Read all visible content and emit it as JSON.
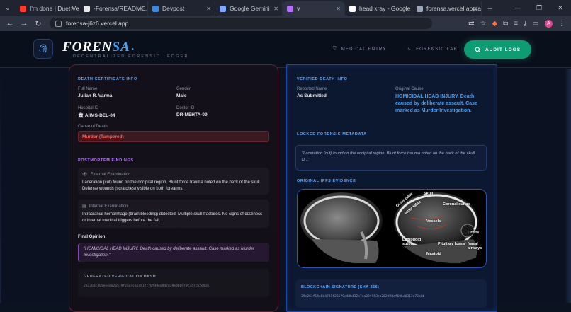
{
  "browser": {
    "tabs": [
      {
        "title": "I'm done | Duet Vers...",
        "fav_color": "#ff3b30",
        "active": false
      },
      {
        "title": "-Forensa/README.m...",
        "fav_color": "#e6e8ec",
        "active": false
      },
      {
        "title": "Devpost",
        "fav_color": "#3a8dde",
        "active": false
      },
      {
        "title": "Google Gemini",
        "fav_color": "#7fa7ff",
        "active": false
      },
      {
        "title": "v",
        "fav_color": "#b66cff",
        "active": true
      },
      {
        "title": "head xray - Google S...",
        "fav_color": "#ffffff",
        "active": false
      },
      {
        "title": "forensa.vercel.app/au...",
        "fav_color": "#9aa4b5",
        "active": false
      }
    ],
    "url": "forensa-j6z6.vercel.app",
    "avatar_letter": "A"
  },
  "header": {
    "brand_main": "FOREN",
    "brand_accent": "SA",
    "tagline": "DECENTRALIZED FORENSIC LEDGER",
    "nav": {
      "medical_entry": "MEDICAL ENTRY",
      "forensic_lab": "FORENSIC LAB",
      "audit_logs": "AUDIT LOGS"
    }
  },
  "left": {
    "title": "DEATH CERTIFICATE INFO",
    "full_name_label": "Full Name",
    "full_name": "Julian R. Varma",
    "gender_label": "Gender",
    "gender": "Male",
    "hospital_label": "Hospital ID",
    "hospital": "AIIMS-DEL-04",
    "doctor_label": "Doctor ID",
    "doctor": "DR-MEHTA-09",
    "cause_label": "Cause of Death",
    "cause": "Murder (Tampered)",
    "findings_title": "POSTMORTEM FINDINGS",
    "external_label": "External Examination",
    "external_text": "Laceration (cut) found on the occipital region. Blunt force trauma noted on the back of the skull. Defense wounds (scratches) visible on both forearms.",
    "internal_label": "Internal Examination",
    "internal_text": "Intracranial hemorrhage (brain bleeding) detected. Multiple skull fractures. No signs of dizziness or internal medical triggers before the fall.",
    "opinion_label": "Final Opinion",
    "opinion_text": "\"HOMICIDAL HEAD INJURY. Death caused by deliberate assault. Case marked as Murder Investigation.\"",
    "hash_label": "GENERATED VERIFICATION HASH",
    "hash": "2a23b3c365eeeda26579f2aa4ca2cb1fc70f39ea947d29edbb970c7a7cb2e916"
  },
  "right": {
    "title": "VERIFIED DEATH INFO",
    "reported_label": "Reported Name",
    "reported": "As Submitted",
    "original_label": "Original Cause",
    "original": "HOMICIDAL HEAD INJURY. Death caused by deliberate assault. Case marked as Murder Investigation.",
    "locked_title": "LOCKED FORENSIC METADATA",
    "locked_text": "\"Laceration (cut) found on the occipital region. Blunt force trauma noted on the back of the skull. D...\"",
    "ipfs_title": "ORIGINAL IPFS EVIDENCE",
    "xray_labels": [
      "Outer table",
      "Inner table",
      "Skull",
      "Coronal suture",
      "Vessels",
      "Orbits",
      "Lambdoid suture",
      "Pituitary fossa",
      "Nasal airways",
      "Mastoid"
    ],
    "chain_label": "BLOCKCHAIN SIGNATURE (SHA-256)",
    "chain_hash": "39c261f14e8b4781f26579c48b432e7ea09f953cb262d28df60bd6313e73b8b"
  },
  "colors": {
    "left_accent": "#e0475a",
    "right_accent": "#3fa3ff",
    "purple": "#b377ff",
    "green": "#0f9c72"
  }
}
